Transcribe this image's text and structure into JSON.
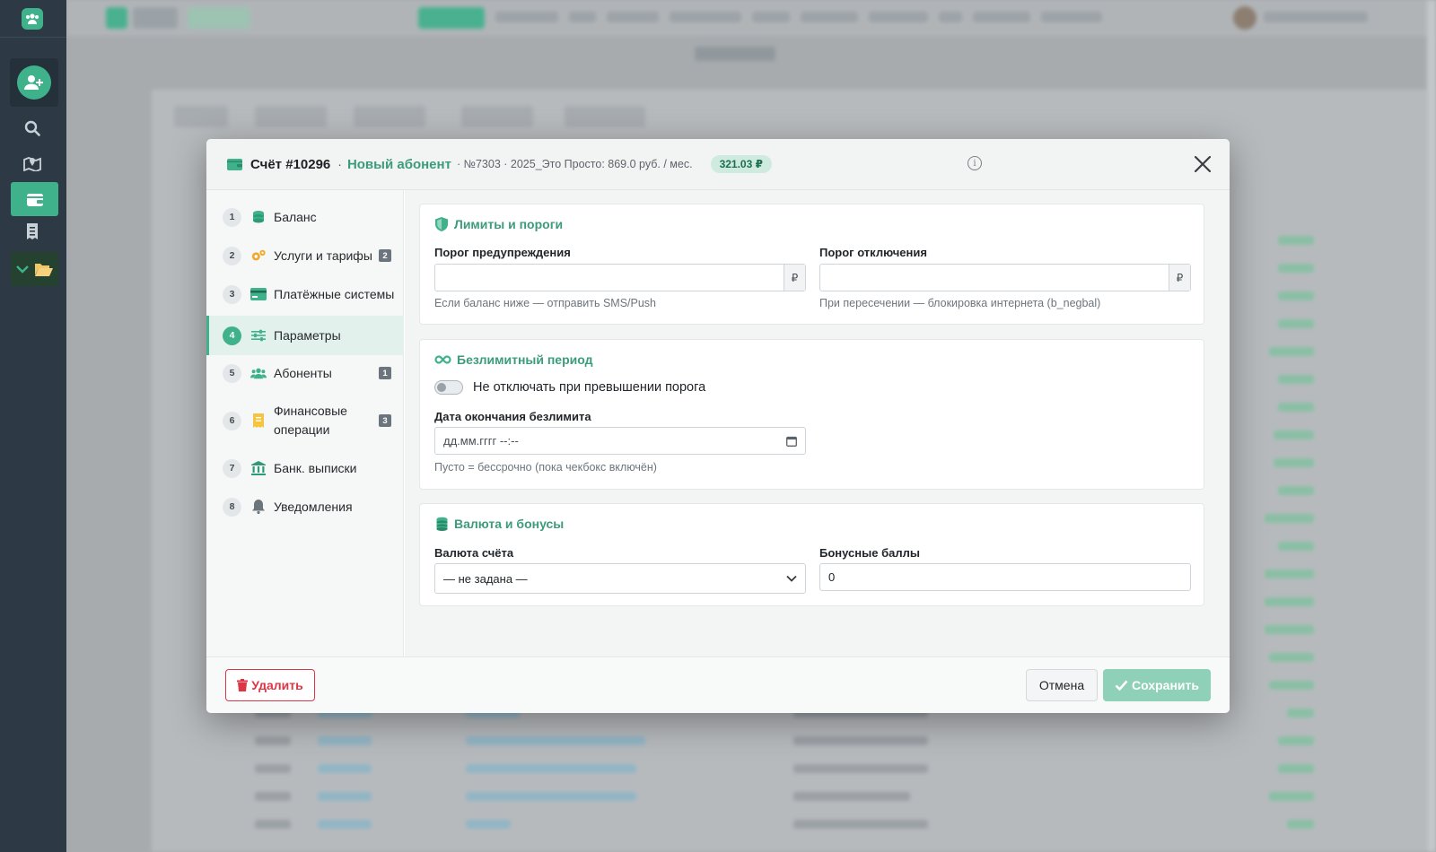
{
  "modal": {
    "title": "Счёт #10296",
    "separator": "·",
    "subtitle": "Новый абонент",
    "info": "· №7303 · 2025_Это Просто: 869.0 руб. / мес.",
    "balance_badge": "321.03 ₽",
    "info_icon": "info-circle-icon",
    "close_icon": "close-icon"
  },
  "nav": {
    "items": [
      {
        "num": "1",
        "label": "Баланс",
        "icon": "coins-icon"
      },
      {
        "num": "2",
        "label": "Услуги и тарифы",
        "icon": "gears-icon",
        "count": "2"
      },
      {
        "num": "3",
        "label": "Платёжные системы",
        "icon": "credit-card-icon"
      },
      {
        "num": "4",
        "label": "Параметры",
        "icon": "sliders-icon",
        "active": true
      },
      {
        "num": "5",
        "label": "Абоненты",
        "icon": "users-icon",
        "count": "1"
      },
      {
        "num": "6",
        "label": "Финансовые операции",
        "label_line1": "Финансовые",
        "label_line2": "операции",
        "icon": "receipt-icon",
        "count": "3"
      },
      {
        "num": "7",
        "label": "Банк. выписки",
        "icon": "bank-icon"
      },
      {
        "num": "8",
        "label": "Уведомления",
        "icon": "bell-icon"
      }
    ]
  },
  "limits": {
    "title": "Лимиты и пороги",
    "warn_label": "Порог предупреждения",
    "warn_value": "",
    "warn_currency": "₽",
    "warn_help": "Если баланс ниже — отправить SMS/Push",
    "off_label": "Порог отключения",
    "off_value": "",
    "off_currency": "₽",
    "off_help": "При пересечении — блокировка интернета (b_negbal)"
  },
  "unlimited": {
    "title": "Безлимитный период",
    "toggle_label": "Не отключать при превышении порога",
    "toggle_on": false,
    "date_label": "Дата окончания безлимита",
    "date_placeholder": "дд.мм.гггг --:--",
    "date_help": "Пусто = бессрочно (пока чекбокс включён)"
  },
  "currency": {
    "title": "Валюта и бонусы",
    "currency_label": "Валюта счёта",
    "currency_value": "— не задана —",
    "bonus_label": "Бонусные баллы",
    "bonus_value": "0"
  },
  "footer": {
    "delete_label": "Удалить",
    "cancel_label": "Отмена",
    "save_label": "Сохранить"
  },
  "colors": {
    "accent": "#3fb28c",
    "sidebar": "#2d3a46",
    "danger": "#dc3545",
    "save_disabled": "#8fd0b8"
  }
}
